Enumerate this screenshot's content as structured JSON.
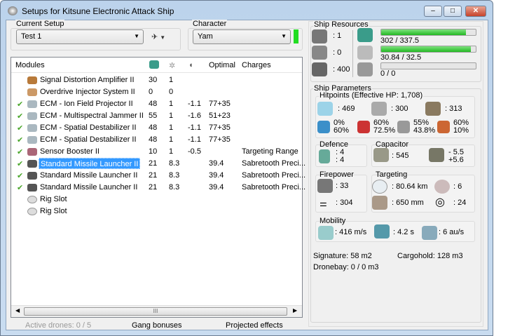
{
  "window": {
    "title": "Setups for Kitsune Electronic Attack Ship"
  },
  "setup": {
    "label": "Current Setup",
    "value": "Test 1"
  },
  "character": {
    "label": "Character",
    "value": "Yam",
    "status_color": "#22dd22"
  },
  "modules": {
    "headers": [
      "Modules",
      "",
      "",
      "",
      "Optimal",
      "Charges"
    ],
    "rows": [
      {
        "active": false,
        "name": "Signal Distortion Amplifier II",
        "cpu": "30",
        "pg": "1",
        "cap": "",
        "optimal": "",
        "charges": "",
        "icon": "amplifier-icon"
      },
      {
        "active": false,
        "name": "Overdrive Injector System II",
        "cpu": "0",
        "pg": "0",
        "cap": "",
        "optimal": "",
        "charges": "",
        "icon": "overdrive-icon"
      },
      {
        "active": true,
        "name": "ECM - Ion Field Projector II",
        "cpu": "48",
        "pg": "1",
        "cap": "-1.1",
        "optimal": "77+35",
        "charges": "",
        "icon": "ecm-icon"
      },
      {
        "active": true,
        "name": "ECM - Multispectral Jammer II",
        "cpu": "55",
        "pg": "1",
        "cap": "-1.6",
        "optimal": "51+23",
        "charges": "",
        "icon": "ecm-icon"
      },
      {
        "active": true,
        "name": "ECM - Spatial Destabilizer II",
        "cpu": "48",
        "pg": "1",
        "cap": "-1.1",
        "optimal": "77+35",
        "charges": "",
        "icon": "ecm-icon"
      },
      {
        "active": true,
        "name": "ECM - Spatial Destabilizer II",
        "cpu": "48",
        "pg": "1",
        "cap": "-1.1",
        "optimal": "77+35",
        "charges": "",
        "icon": "ecm-icon"
      },
      {
        "active": true,
        "name": "Sensor Booster II",
        "cpu": "10",
        "pg": "1",
        "cap": "-0.5",
        "optimal": "",
        "charges": "Targeting Range",
        "icon": "sensor-booster-icon"
      },
      {
        "active": true,
        "name": "Standard Missile Launcher II",
        "cpu": "21",
        "pg": "8.3",
        "cap": "",
        "optimal": "39.4",
        "charges": "Sabretooth Preci...",
        "icon": "launcher-icon",
        "selected": true
      },
      {
        "active": true,
        "name": "Standard Missile Launcher II",
        "cpu": "21",
        "pg": "8.3",
        "cap": "",
        "optimal": "39.4",
        "charges": "Sabretooth Preci...",
        "icon": "launcher-icon"
      },
      {
        "active": true,
        "name": "Standard Missile Launcher II",
        "cpu": "21",
        "pg": "8.3",
        "cap": "",
        "optimal": "39.4",
        "charges": "Sabretooth Preci...",
        "icon": "launcher-icon"
      },
      {
        "active": false,
        "name": "Rig Slot",
        "cpu": "",
        "pg": "",
        "cap": "",
        "optimal": "",
        "charges": "",
        "icon": "rig-slot-icon"
      },
      {
        "active": false,
        "name": "Rig Slot",
        "cpu": "",
        "pg": "",
        "cap": "",
        "optimal": "",
        "charges": "",
        "icon": "rig-slot-icon"
      }
    ]
  },
  "footer": {
    "drones": "Active drones: 0 / 5",
    "gang": "Gang bonuses",
    "projected": "Projected effects",
    "scroll_grip": "III"
  },
  "resources": {
    "title": "Ship Resources",
    "turrets": ": 1",
    "launchers": ": 0",
    "calibration": ": 400",
    "cpu": {
      "text": "302 / 337.5",
      "fraction": 0.895
    },
    "powergrid": {
      "text": "30.84 / 32.5",
      "fraction": 0.949
    },
    "drone_bw": {
      "text": "0 / 0",
      "fraction": 0
    }
  },
  "params": {
    "title": "Ship Parameters",
    "hp_title": "Hitpoints (Effective HP: 1,708)",
    "shield": ": 469",
    "armor": ": 300",
    "structure": ": 313",
    "resists": [
      [
        "0%",
        "60%"
      ],
      [
        "60%",
        "72.5%"
      ],
      [
        "55%",
        "43.8%"
      ],
      [
        "60%",
        "10%"
      ]
    ],
    "defence": {
      "title": "Defence",
      "a": ": 4",
      "b": ": 4"
    },
    "capacitor": {
      "title": "Capacitor",
      "amount": ": 545",
      "use": "- 5.5",
      "recharge": "+5.6"
    },
    "firepower": {
      "title": "Firepower",
      "turret": ": 33",
      "missile": ": 304"
    },
    "targeting": {
      "title": "Targeting",
      "range": ": 80.64 km",
      "targets": ": 6",
      "sigres": ": 650 mm",
      "scan": ": 24"
    },
    "mobility": {
      "title": "Mobility",
      "speed": ": 416 m/s",
      "align": ": 4.2 s",
      "warp": ": 6 au/s"
    },
    "signature": "Signature: 58 m2",
    "cargo": "Cargohold: 128 m3",
    "dronebay": "Dronebay: 0 / 0 m3"
  }
}
